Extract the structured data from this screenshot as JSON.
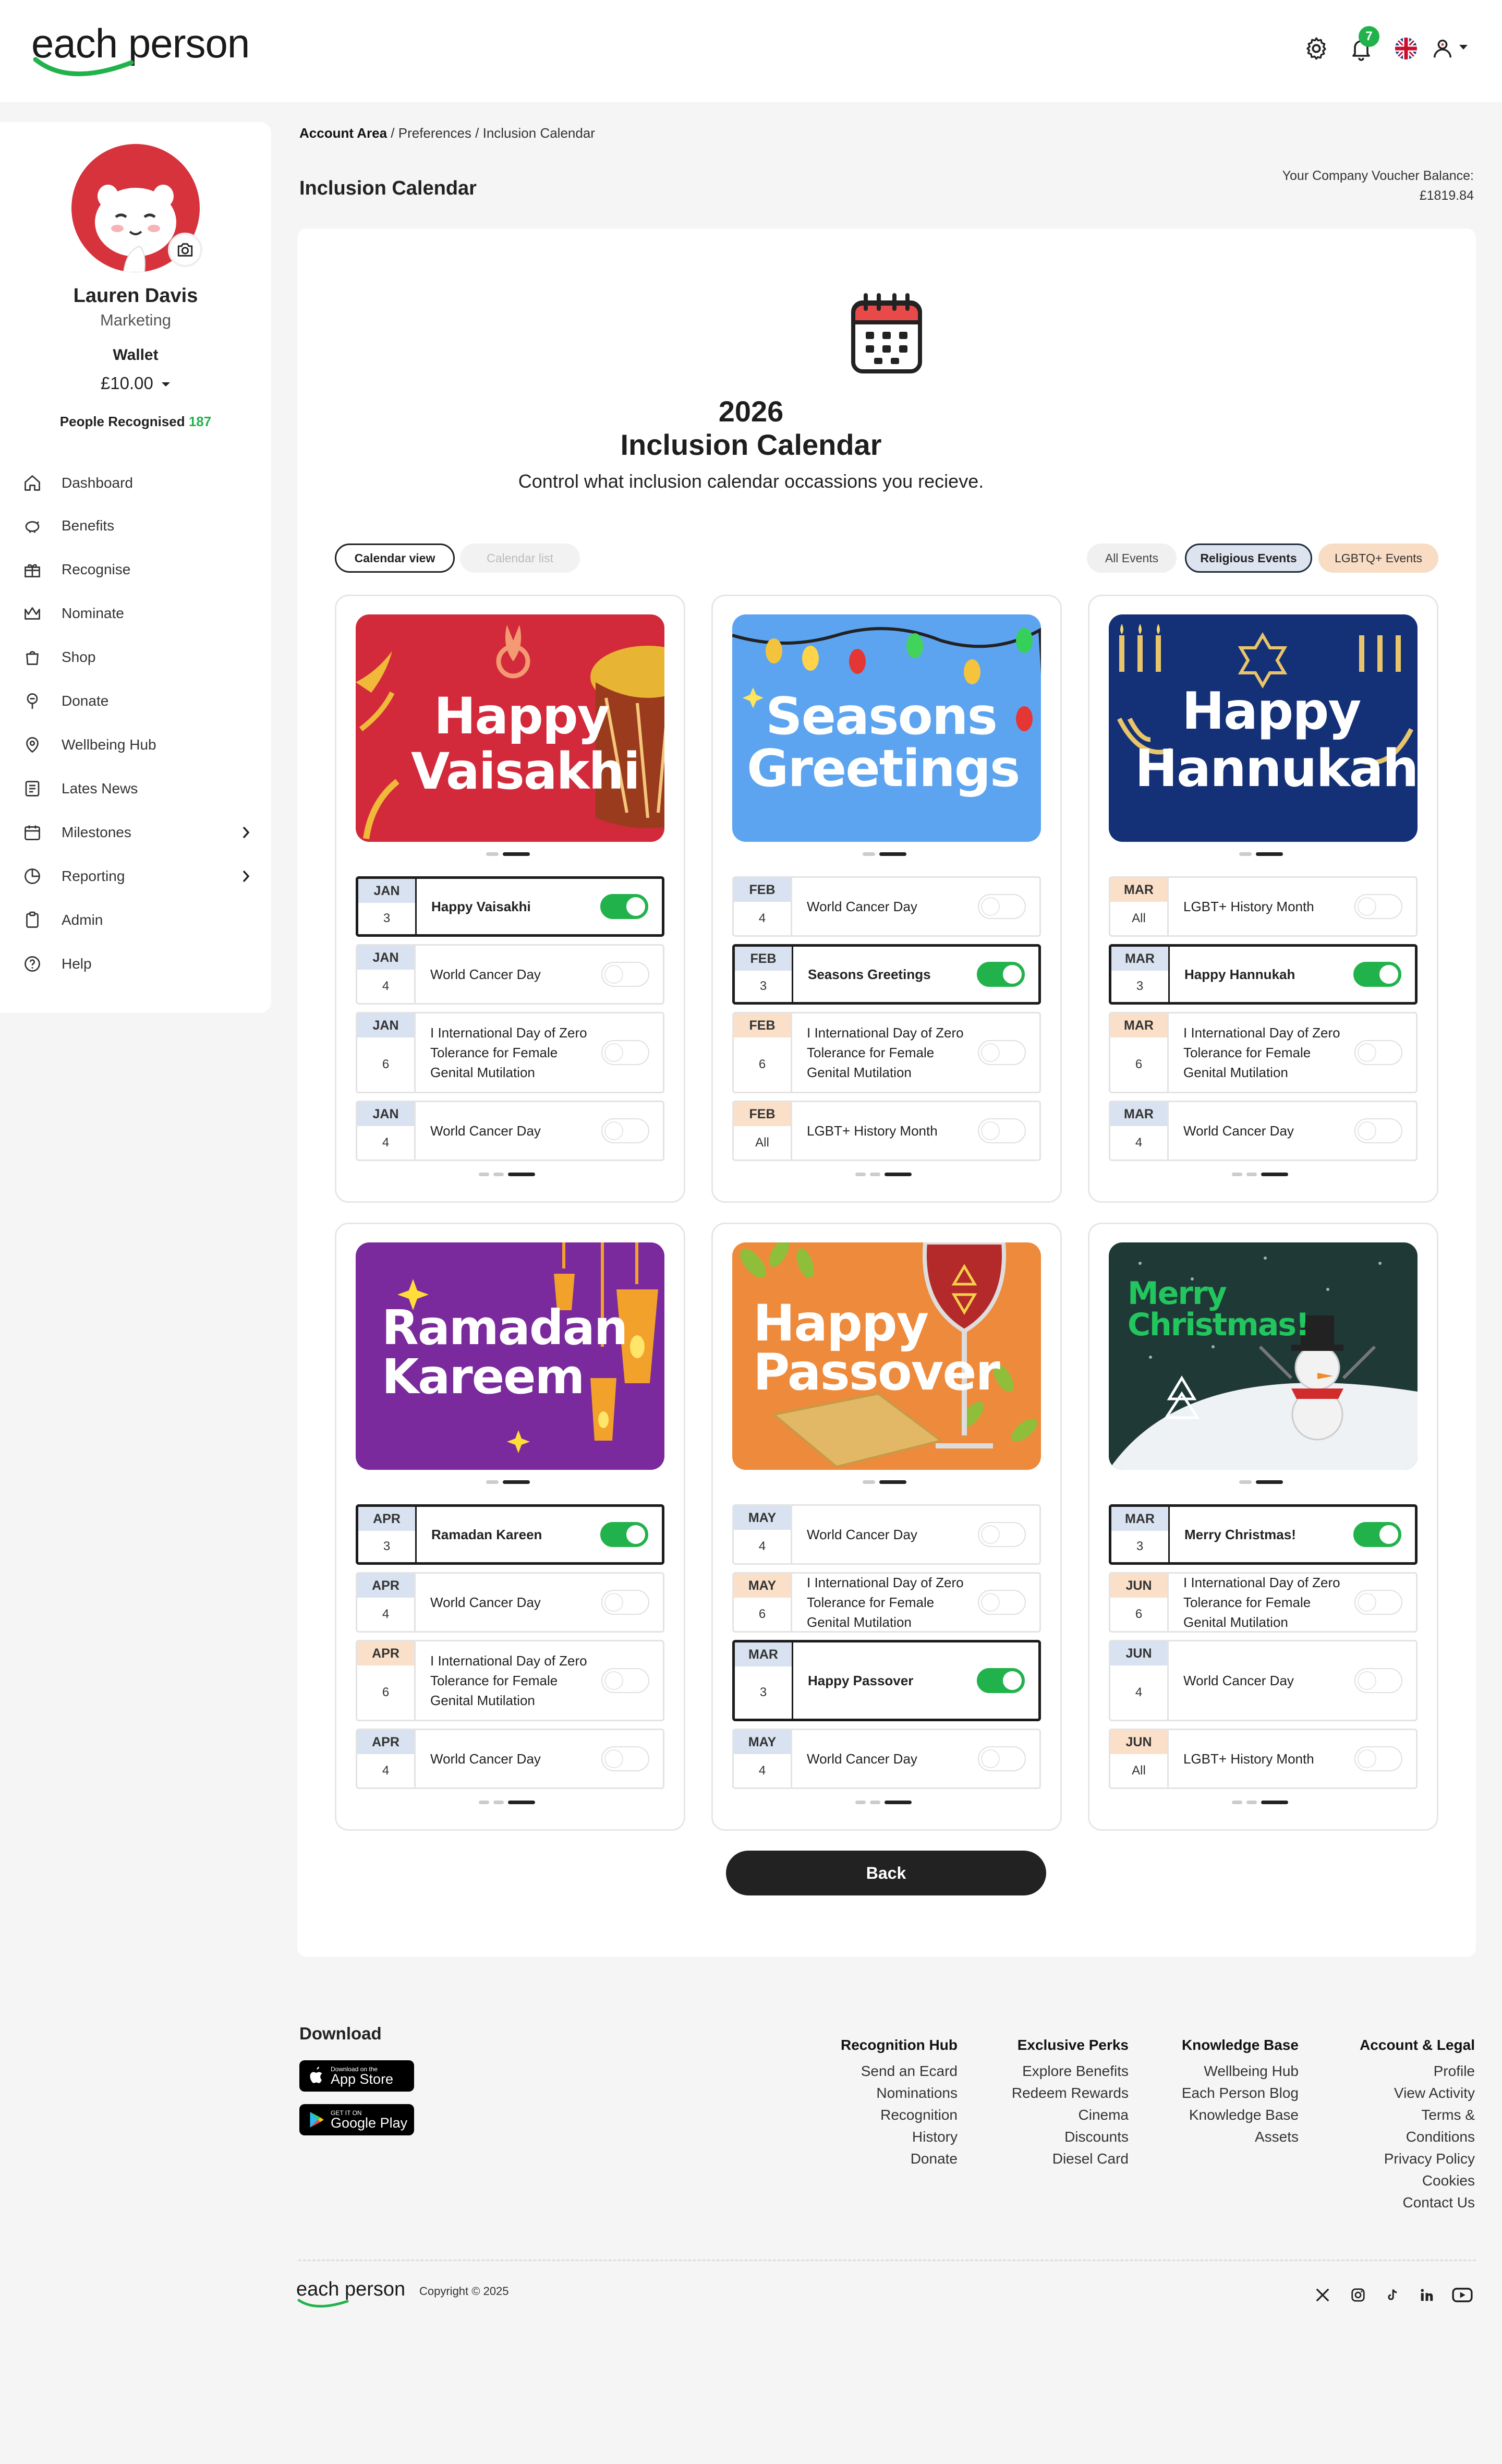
{
  "brand": {
    "logo_a": "each",
    "logo_b": "person",
    "accent": "#22b24c"
  },
  "header": {
    "notification_count": "7",
    "icons": [
      "gear-icon",
      "bell-icon",
      "uk-flag-icon",
      "user-icon",
      "caret-down-icon"
    ]
  },
  "sidebar": {
    "user_name": "Lauren Davis",
    "user_role": "Marketing",
    "wallet_label": "Wallet",
    "wallet_value": "£10.00",
    "people_recognised_label": "People Recognised",
    "people_recognised_count": "187",
    "nav": [
      {
        "label": "Dashboard",
        "icon": "home-icon"
      },
      {
        "label": "Benefits",
        "icon": "piggy-bank-icon"
      },
      {
        "label": "Recognise",
        "icon": "gift-icon"
      },
      {
        "label": "Nominate",
        "icon": "crown-icon"
      },
      {
        "label": "Shop",
        "icon": "shopping-bag-icon"
      },
      {
        "label": "Donate",
        "icon": "donate-icon"
      },
      {
        "label": "Wellbeing Hub",
        "icon": "wellbeing-icon"
      },
      {
        "label": "Lates News",
        "icon": "news-icon"
      },
      {
        "label": "Milestones",
        "icon": "calendar-icon"
      },
      {
        "label": "Reporting",
        "icon": "chart-icon"
      },
      {
        "label": "Admin",
        "icon": "clipboard-icon"
      },
      {
        "label": "Help",
        "icon": "help-icon"
      }
    ]
  },
  "breadcrumb": {
    "root": "Account Area",
    "rest": " / Preferences / Inclusion Calendar"
  },
  "page": {
    "title": "Inclusion Calendar",
    "voucher_label": "Your Company Voucher Balance:",
    "voucher_value": "£1819.84",
    "year": "2026",
    "calendar_title": "Inclusion Calendar",
    "subtitle": "Control what inclusion calendar occassions you recieve.",
    "back_label": "Back"
  },
  "view_toggle": {
    "calendar_view": "Calendar view",
    "calendar_list": "Calendar list"
  },
  "filters": {
    "all": "All Events",
    "religious": "Religious Events",
    "lgbtq": "LGBTQ+ Events"
  },
  "cards": [
    {
      "banner_words": [
        "Happy",
        "Vaisakhi"
      ],
      "banner_color": "#d2293b",
      "rows": [
        {
          "month": "JAN",
          "day": "3",
          "name": "Happy Vaisakhi",
          "on": true,
          "tone": "blue"
        },
        {
          "month": "JAN",
          "day": "4",
          "name": "World Cancer Day",
          "on": false,
          "tone": "blue"
        },
        {
          "month": "JAN",
          "day": "6",
          "name": "I International Day of Zero Tolerance for Female Genital Mutilation",
          "on": false,
          "tone": "blue"
        },
        {
          "month": "JAN",
          "day": "4",
          "name": "World Cancer Day",
          "on": false,
          "tone": "blue"
        }
      ]
    },
    {
      "banner_words": [
        "Seasons",
        "Greetings"
      ],
      "banner_color": "#5da4f0",
      "rows": [
        {
          "month": "FEB",
          "day": "4",
          "name": "World Cancer Day",
          "on": false,
          "tone": "blue"
        },
        {
          "month": "FEB",
          "day": "3",
          "name": "Seasons Greetings",
          "on": true,
          "tone": "blue"
        },
        {
          "month": "FEB",
          "day": "6",
          "name": "I International Day of Zero Tolerance for Female Genital Mutilation",
          "on": false,
          "tone": "peach"
        },
        {
          "month": "FEB",
          "day": "All",
          "name": "LGBT+ History Month",
          "on": false,
          "tone": "peach"
        }
      ]
    },
    {
      "banner_words": [
        "Happy",
        "Hannukah"
      ],
      "banner_color": "#143177",
      "rows": [
        {
          "month": "MAR",
          "day": "All",
          "name": "LGBT+ History Month",
          "on": false,
          "tone": "peach"
        },
        {
          "month": "MAR",
          "day": "3",
          "name": "Happy Hannukah",
          "on": true,
          "tone": "blue"
        },
        {
          "month": "MAR",
          "day": "6",
          "name": "I International Day of Zero Tolerance for Female Genital Mutilation",
          "on": false,
          "tone": "peach"
        },
        {
          "month": "MAR",
          "day": "4",
          "name": "World Cancer Day",
          "on": false,
          "tone": "blue"
        }
      ]
    },
    {
      "banner_words": [
        "Ramadan",
        "Kareem"
      ],
      "banner_color": "#7a2a9c",
      "rows": [
        {
          "month": "APR",
          "day": "3",
          "name": "Ramadan Kareen",
          "on": true,
          "tone": "blue"
        },
        {
          "month": "APR",
          "day": "4",
          "name": "World Cancer Day",
          "on": false,
          "tone": "blue"
        },
        {
          "month": "APR",
          "day": "6",
          "name": "I International Day of Zero Tolerance for Female Genital Mutilation",
          "on": false,
          "tone": "peach"
        },
        {
          "month": "APR",
          "day": "4",
          "name": "World Cancer Day",
          "on": false,
          "tone": "blue"
        }
      ]
    },
    {
      "banner_words": [
        "Happy",
        "Passover"
      ],
      "banner_color": "#ee8a3b",
      "rows": [
        {
          "month": "MAY",
          "day": "4",
          "name": "World Cancer Day",
          "on": false,
          "tone": "blue"
        },
        {
          "month": "MAY",
          "day": "6",
          "name": "I International Day of Zero Tolerance for Female Genital Mutilation",
          "on": false,
          "tone": "peach"
        },
        {
          "month": "MAR",
          "day": "3",
          "name": "Happy Passover",
          "on": true,
          "tone": "blue"
        },
        {
          "month": "MAY",
          "day": "4",
          "name": "World Cancer Day",
          "on": false,
          "tone": "blue"
        }
      ]
    },
    {
      "banner_words": [
        "Merry",
        "Christmas!"
      ],
      "banner_color": "#1f3a36",
      "rows": [
        {
          "month": "MAR",
          "day": "3",
          "name": "Merry Christmas!",
          "on": true,
          "tone": "blue"
        },
        {
          "month": "JUN",
          "day": "6",
          "name": "I International Day of Zero Tolerance for Female Genital Mutilation",
          "on": false,
          "tone": "peach"
        },
        {
          "month": "JUN",
          "day": "4",
          "name": "World Cancer Day",
          "on": false,
          "tone": "blue"
        },
        {
          "month": "JUN",
          "day": "All",
          "name": "LGBT+ History Month",
          "on": false,
          "tone": "peach"
        }
      ]
    }
  ],
  "footer": {
    "download_title": "Download",
    "app_store_small": "Download on the",
    "app_store_big": "App Store",
    "google_small": "GET IT ON",
    "google_big": "Google Play",
    "columns": [
      {
        "title": "Recognition Hub",
        "links": [
          "Send an Ecard",
          "Nominations",
          "Recognition",
          "History",
          "Donate"
        ]
      },
      {
        "title": "Exclusive Perks",
        "links": [
          "Explore Benefits",
          "Redeem Rewards",
          "Cinema",
          "Discounts",
          "Diesel Card"
        ]
      },
      {
        "title": "Knowledge Base",
        "links": [
          "Wellbeing Hub",
          "Each Person Blog",
          "Knowledge Base",
          "Assets"
        ]
      },
      {
        "title": "Account & Legal",
        "links": [
          "Profile",
          "View Activity",
          "Terms &",
          "Conditions",
          "Privacy Policy",
          "Cookies",
          "Contact Us"
        ]
      }
    ],
    "copyright": "Copyright © 2025",
    "social": [
      "x-icon",
      "instagram-icon",
      "tiktok-icon",
      "linkedin-icon",
      "youtube-icon"
    ]
  }
}
